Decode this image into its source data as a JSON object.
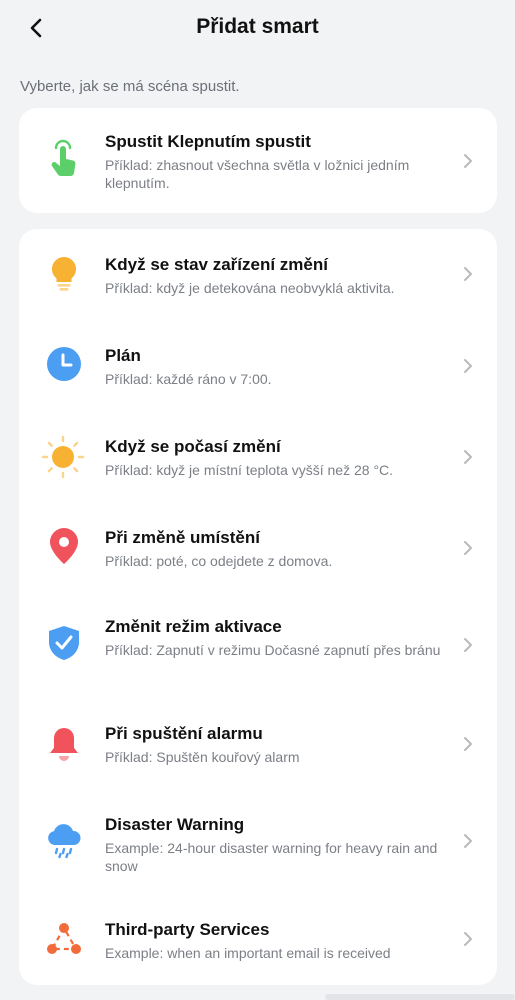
{
  "header": {
    "title": "Přidat smart"
  },
  "subtitle": "Vyberte, jak se má scéna spustit.",
  "tap_option": {
    "name": "Spustit Klepnutím spustit",
    "desc": "Příklad: zhasnout všechna světla v ložnici jedním klepnutím.",
    "icon": "tap-hand-icon",
    "color": "#5ccf6a"
  },
  "options": [
    {
      "name": "Když se stav zařízení změní",
      "desc": "Příklad: když je detekována neobvyklá aktivita.",
      "icon": "bulb-icon",
      "color": "#f7b234"
    },
    {
      "name": "Plán",
      "desc": "Příklad: každé ráno v 7:00.",
      "icon": "clock-icon",
      "color": "#4b9ef2"
    },
    {
      "name": "Když se počasí změní",
      "desc": "Příklad: když je místní teplota vyšší než 28 °C.",
      "icon": "sun-icon",
      "color": "#f7b234"
    },
    {
      "name": "Při změně umístění",
      "desc": "Příklad: poté, co odejdete z domova.",
      "icon": "location-pin-icon",
      "color": "#f0535b"
    },
    {
      "name": "Změnit režim aktivace",
      "desc": "Příklad: Zapnutí v režimu Dočasné zapnutí přes bránu",
      "icon": "shield-check-icon",
      "color": "#4b9ef2"
    },
    {
      "name": "Při spuštění alarmu",
      "desc": "Příklad: Spuštěn kouřový alarm",
      "icon": "bell-icon",
      "color": "#f0535b"
    },
    {
      "name": "Disaster Warning",
      "desc": "Example: 24-hour disaster warning for heavy rain and snow",
      "icon": "rain-cloud-icon",
      "color": "#4b9ef2"
    },
    {
      "name": "Third-party Services",
      "desc": "Example: when an important email is received",
      "icon": "services-icon",
      "color": "#f26b3a"
    }
  ]
}
